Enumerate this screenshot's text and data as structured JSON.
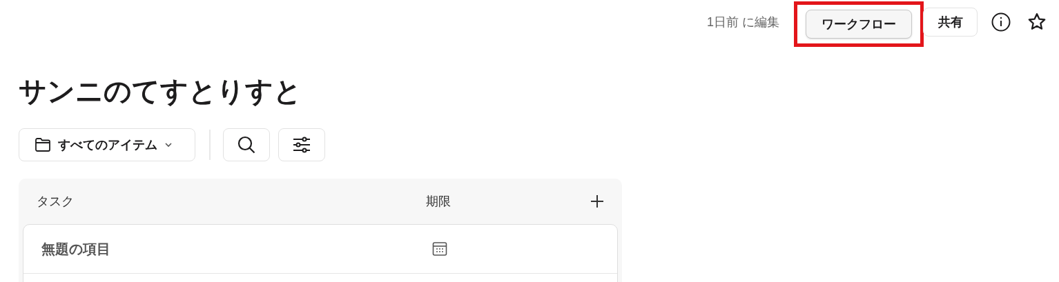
{
  "header": {
    "edited": "1日前 に編集",
    "buttons": [
      {
        "label": "ワークフロー",
        "kind": "primary",
        "highlighted": true
      },
      {
        "label": "共有",
        "kind": "outline",
        "highlighted": false
      }
    ]
  },
  "title": "サンニのてすとりすと",
  "toolbar": {
    "view": "すべてのアイテム"
  },
  "table": {
    "columns": [
      "タスク",
      "期限"
    ],
    "rows": [
      {
        "task": "無題の項目"
      }
    ]
  }
}
